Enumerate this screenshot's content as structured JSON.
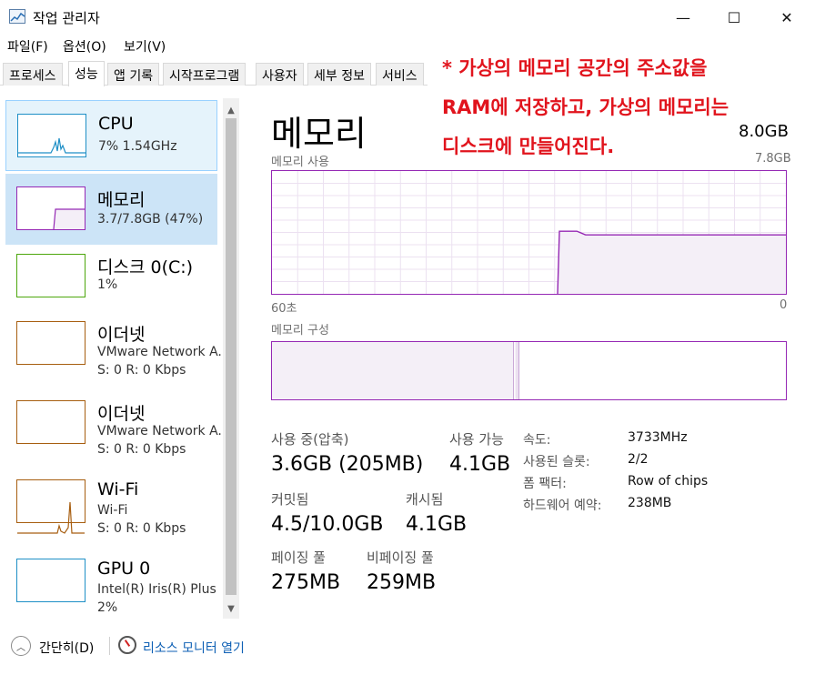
{
  "window": {
    "title": "작업 관리자",
    "minimize": "—",
    "maximize": "☐",
    "close": "✕",
    "icon": "task-manager-icon"
  },
  "menu": [
    "파일(F)",
    "옵션(O)",
    "보기(V)"
  ],
  "tabs": [
    "프로세스",
    "성능",
    "앱 기록",
    "시작프로그램",
    "사용자",
    "세부 정보",
    "서비스"
  ],
  "active_tab": "성능",
  "annotation": {
    "lines": [
      "* 가상의 메모리 공간의 주소값을",
      "RAM에 저장하고, 가상의 메모리는",
      "디스크에 만들어진다."
    ],
    "color": "#e1141d"
  },
  "sidebar": {
    "items": [
      {
        "title": "CPU",
        "sub1": "7%  1.54GHz",
        "sub2": "",
        "color": "#1e8fc6"
      },
      {
        "title": "메모리",
        "sub1": "3.7/7.8GB (47%)",
        "sub2": "",
        "color": "#9528b4"
      },
      {
        "title": "디스크 0(C:)",
        "sub1": "1%",
        "sub2": "",
        "color": "#4da60c"
      },
      {
        "title": "이더넷",
        "sub1": "VMware Network A...",
        "sub2": "S: 0  R: 0 Kbps",
        "color": "#a75e10"
      },
      {
        "title": "이더넷",
        "sub1": "VMware Network A...",
        "sub2": "S: 0  R: 0 Kbps",
        "color": "#a75e10"
      },
      {
        "title": "Wi-Fi",
        "sub1": "Wi-Fi",
        "sub2": "S: 0  R: 0 Kbps",
        "color": "#a75e10"
      },
      {
        "title": "GPU 0",
        "sub1": "Intel(R) Iris(R) Plus ...",
        "sub2": "2%",
        "color": "#1e8fc6"
      }
    ]
  },
  "main": {
    "title": "메모리",
    "total": "8.0GB",
    "usage_label": "메모리 사용",
    "usage_max": "7.8GB",
    "time_left": "60초",
    "time_right": "0",
    "composition_label": "메모리 구성",
    "accent": "#9528b4",
    "usage_history_fraction": [
      0.0,
      0.0,
      0.0,
      0.0,
      0.0,
      0.0,
      0.0,
      0.0,
      0.0,
      0.0,
      0.0,
      0.0,
      0.0,
      0.0,
      0.0,
      0.0,
      0.0,
      0.0,
      0.0,
      0.0,
      0.0,
      0.0,
      0.0,
      0.0,
      0.0,
      0.0,
      0.0,
      0.0,
      0.0,
      0.0,
      0.0,
      0.0,
      0.0,
      0.51,
      0.51,
      0.51,
      0.48,
      0.48,
      0.48,
      0.48,
      0.48,
      0.48,
      0.48,
      0.48,
      0.48,
      0.48,
      0.48,
      0.48,
      0.48,
      0.48,
      0.48,
      0.48,
      0.48,
      0.48,
      0.48,
      0.48,
      0.48,
      0.48,
      0.48,
      0.48
    ],
    "composition_in_use_fraction": 0.47
  },
  "stats": {
    "in_use_label": "사용 중(압축)",
    "in_use_value": "3.6GB (205MB)",
    "available_label": "사용 가능",
    "available_value": "4.1GB",
    "committed_label": "커밋됨",
    "committed_value": "4.5/10.0GB",
    "cached_label": "캐시됨",
    "cached_value": "4.1GB",
    "paged_label": "페이징 풀",
    "paged_value": "275MB",
    "nonpaged_label": "비페이징 풀",
    "nonpaged_value": "259MB"
  },
  "info": [
    {
      "label": "속도:",
      "value": "3733MHz"
    },
    {
      "label": "사용된 슬롯:",
      "value": "2/2"
    },
    {
      "label": "폼 팩터:",
      "value": "Row of chips"
    },
    {
      "label": "하드웨어 예약:",
      "value": "238MB"
    }
  ],
  "footer": {
    "fewer_details": "간단히(D)",
    "resource_monitor": "리소스 모니터 열기"
  }
}
